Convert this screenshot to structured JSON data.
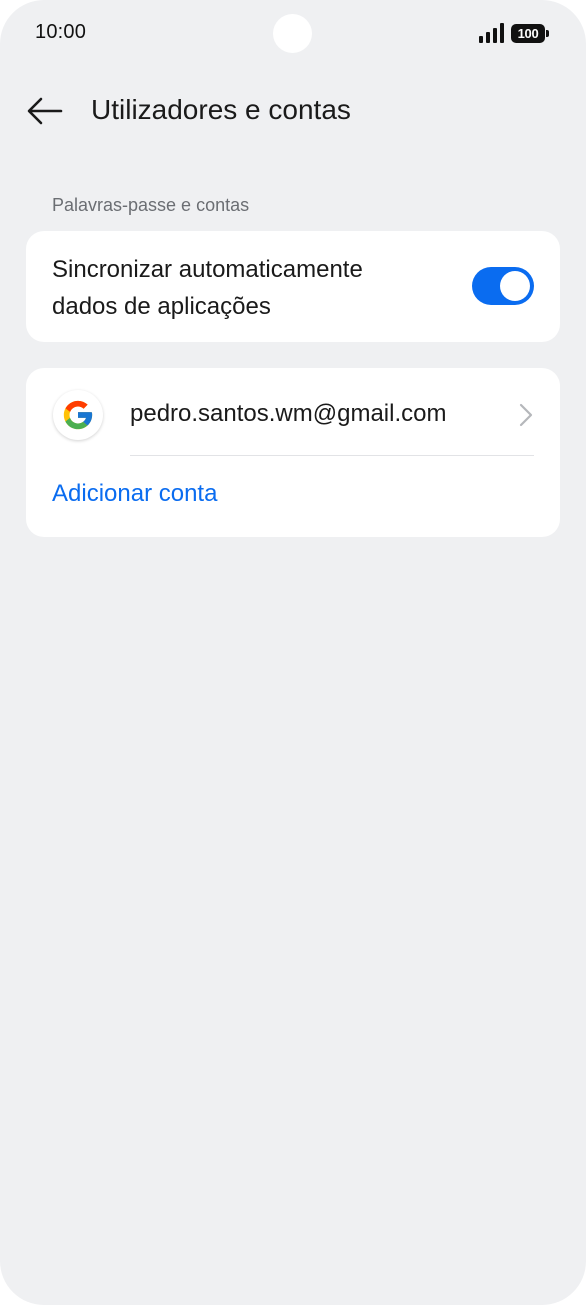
{
  "status_bar": {
    "time": "10:00",
    "battery_level": "100",
    "signal_icon": "signal-bars-icon",
    "battery_icon": "battery-icon"
  },
  "header": {
    "back_icon": "arrow-left-icon",
    "title": "Utilizadores e contas"
  },
  "section": {
    "label": "Palavras-passe e contas"
  },
  "sync": {
    "label": "Sincronizar automaticamente dados de aplicações",
    "enabled": true,
    "accent_color": "#0a6cf0"
  },
  "accounts": {
    "items": [
      {
        "icon": "google-logo-icon",
        "email": "pedro.santos.wm@gmail.com"
      }
    ],
    "add_label": "Adicionar conta",
    "link_color": "#0a6cf0"
  },
  "colors": {
    "background": "#eff0f2",
    "card": "#ffffff"
  }
}
